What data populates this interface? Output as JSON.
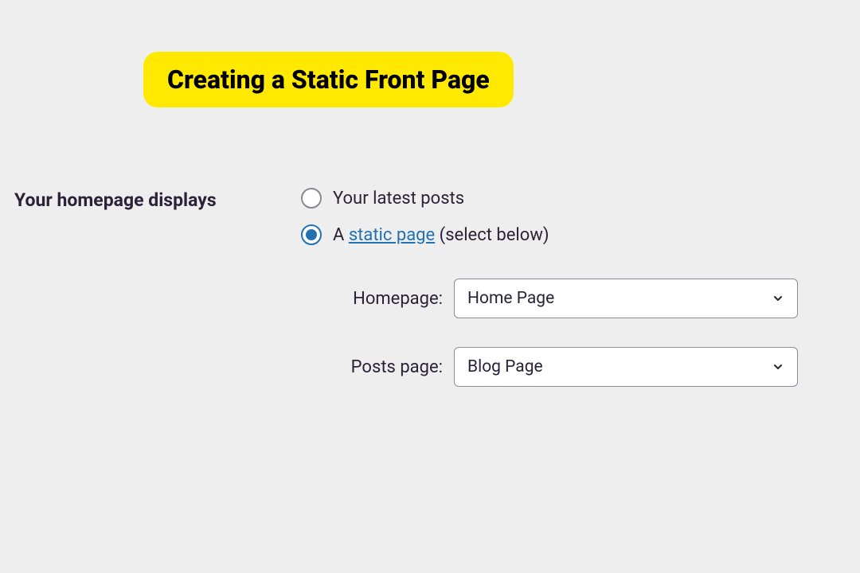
{
  "title": "Creating a Static Front Page",
  "section_label": "Your homepage displays",
  "radio": {
    "latest": {
      "label": "Your latest posts",
      "selected": false
    },
    "static": {
      "prefix": "A ",
      "link": "static page",
      "suffix": " (select below)",
      "selected": true
    }
  },
  "selects": {
    "homepage": {
      "label": "Homepage:",
      "value": "Home Page"
    },
    "posts": {
      "label": "Posts page:",
      "value": "Blog Page"
    }
  }
}
